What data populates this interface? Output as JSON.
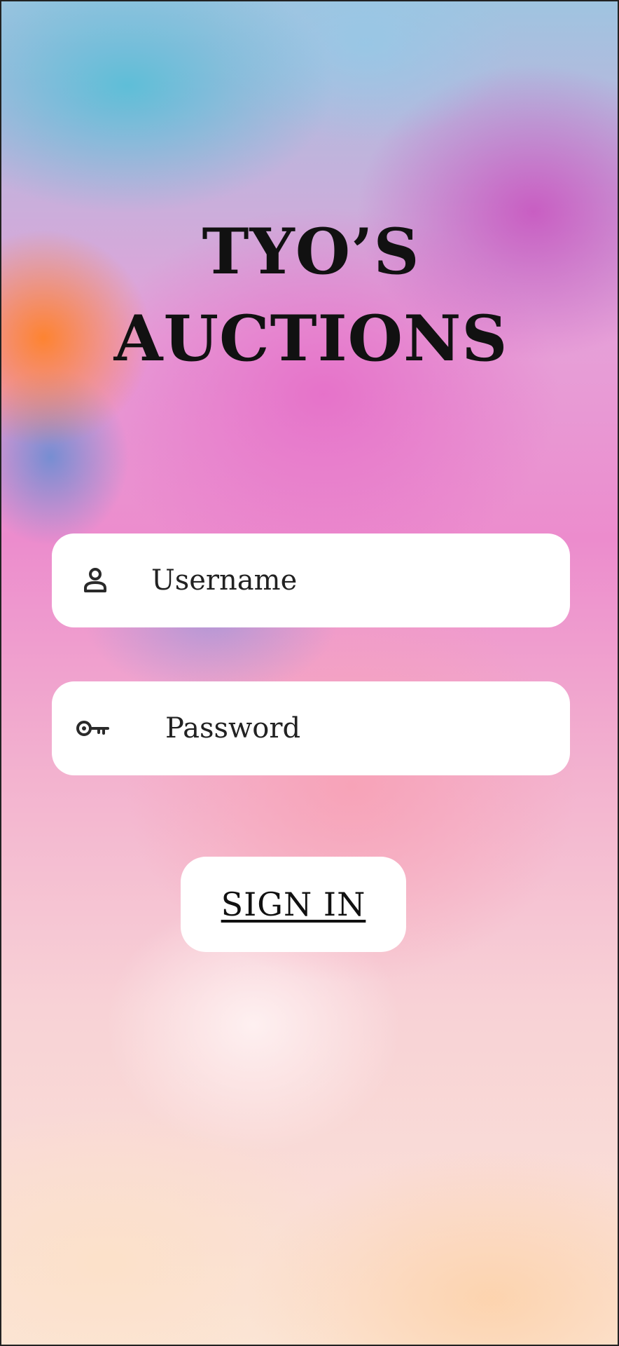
{
  "app": {
    "title_line1": "TYO’S",
    "title_line2": "AUCTIONS"
  },
  "login": {
    "username": {
      "placeholder": "Username",
      "value": "",
      "icon": "user-icon"
    },
    "password": {
      "placeholder": "Password",
      "value": "",
      "icon": "key-icon"
    },
    "signin_label": "SIGN IN"
  },
  "colors": {
    "field_background": "#ffffff",
    "text": "#111111",
    "border": "#222222"
  }
}
